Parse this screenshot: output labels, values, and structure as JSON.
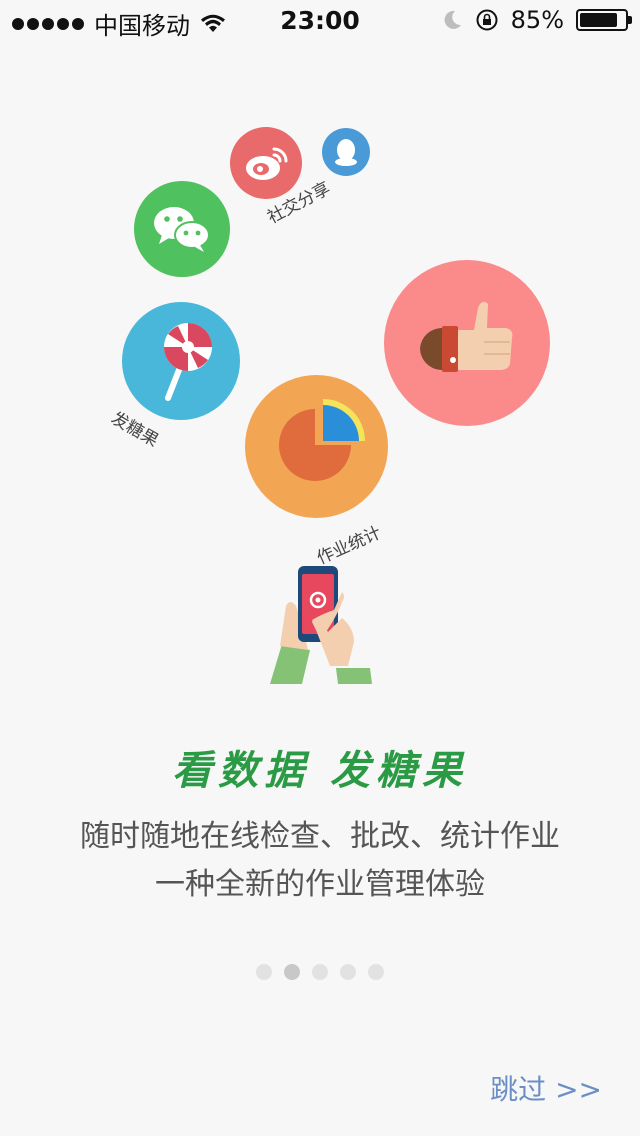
{
  "status_bar": {
    "carrier": "中国移动",
    "time": "23:00",
    "battery_percent": "85%",
    "battery_level": 0.85
  },
  "illustration": {
    "social_label": "社交分享",
    "candy_label": "发糖果",
    "stats_label": "作业统计"
  },
  "headline": "看数据 发糖果",
  "subtext": [
    "随时随地在线检查、批改、统计作业",
    "一种全新的作业管理体验"
  ],
  "pager": {
    "count": 5,
    "active_index": 1
  },
  "skip_label": "跳过 >>"
}
